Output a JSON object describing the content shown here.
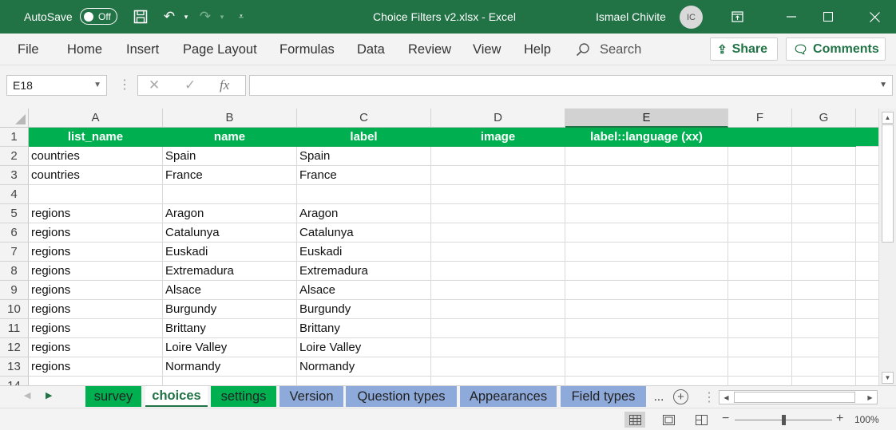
{
  "app": {
    "autosave_label": "AutoSave",
    "autosave_state": "Off",
    "title": "Choice Filters v2.xlsx  -  Excel",
    "user_name": "Ismael Chivite",
    "user_initials": "IC"
  },
  "ribbon": {
    "tabs": [
      "File",
      "Home",
      "Insert",
      "Page Layout",
      "Formulas",
      "Data",
      "Review",
      "View",
      "Help"
    ],
    "search_label": "Search",
    "share_label": "Share",
    "comments_label": "Comments"
  },
  "formula_bar": {
    "name_box": "E18",
    "cancel_icon": "✕",
    "enter_icon": "✓",
    "fx_label": "fx",
    "value": ""
  },
  "grid": {
    "columns": [
      "A",
      "B",
      "C",
      "D",
      "E",
      "F",
      "G"
    ],
    "selected_column": "E",
    "rows": [
      {
        "num": "1",
        "cells": [
          "list_name",
          "name",
          "label",
          "image",
          "label::language (xx)",
          "",
          ""
        ]
      },
      {
        "num": "2",
        "cells": [
          "countries",
          "Spain",
          "Spain",
          "",
          "",
          "",
          ""
        ]
      },
      {
        "num": "3",
        "cells": [
          "countries",
          "France",
          "France",
          "",
          "",
          "",
          ""
        ]
      },
      {
        "num": "4",
        "cells": [
          "",
          "",
          "",
          "",
          "",
          "",
          ""
        ]
      },
      {
        "num": "5",
        "cells": [
          "regions",
          "Aragon",
          "Aragon",
          "",
          "",
          "",
          ""
        ]
      },
      {
        "num": "6",
        "cells": [
          "regions",
          "Catalunya",
          "Catalunya",
          "",
          "",
          "",
          ""
        ]
      },
      {
        "num": "7",
        "cells": [
          "regions",
          "Euskadi",
          "Euskadi",
          "",
          "",
          "",
          ""
        ]
      },
      {
        "num": "8",
        "cells": [
          "regions",
          "Extremadura",
          "Extremadura",
          "",
          "",
          "",
          ""
        ]
      },
      {
        "num": "9",
        "cells": [
          "regions",
          "Alsace",
          "Alsace",
          "",
          "",
          "",
          ""
        ]
      },
      {
        "num": "10",
        "cells": [
          "regions",
          "Burgundy",
          "Burgundy",
          "",
          "",
          "",
          ""
        ]
      },
      {
        "num": "11",
        "cells": [
          "regions",
          "Brittany",
          "Brittany",
          "",
          "",
          "",
          ""
        ]
      },
      {
        "num": "12",
        "cells": [
          "regions",
          "Loire Valley",
          "Loire Valley",
          "",
          "",
          "",
          ""
        ]
      },
      {
        "num": "13",
        "cells": [
          "regions",
          "Normandy",
          "Normandy",
          "",
          "",
          "",
          ""
        ]
      },
      {
        "num": "14",
        "cells": [
          "",
          "",
          "",
          "",
          "",
          "",
          ""
        ]
      }
    ]
  },
  "sheet_tabs": [
    {
      "label": "survey",
      "style": "green"
    },
    {
      "label": "choices",
      "style": "active"
    },
    {
      "label": "settings",
      "style": "green"
    },
    {
      "label": "Version",
      "style": "blue"
    },
    {
      "label": "Question types",
      "style": "blue"
    },
    {
      "label": "Appearances",
      "style": "blue"
    },
    {
      "label": "Field types",
      "style": "blue"
    }
  ],
  "sheet_tabs_more": "...",
  "status": {
    "zoom_label": "100%",
    "zoom_percent": 100
  },
  "colors": {
    "title_bar": "#217346",
    "header_row": "#00b050",
    "tab_green": "#00b050",
    "tab_blue": "#8eaadb"
  }
}
